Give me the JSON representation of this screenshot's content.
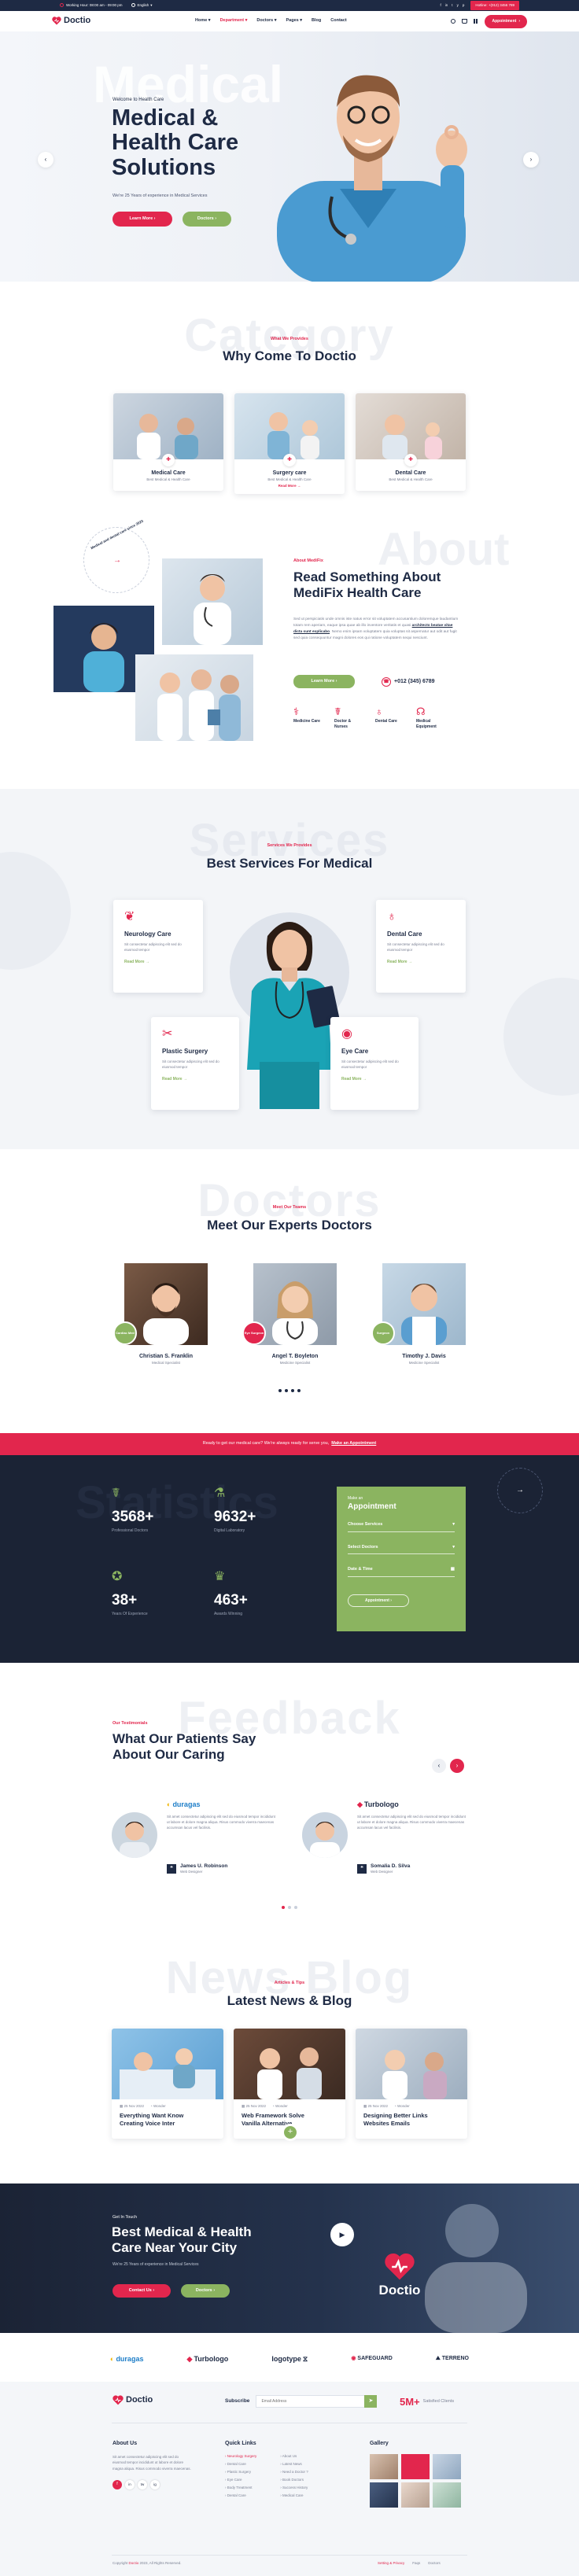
{
  "topbar": {
    "hours": "Working Hour: 08:00 am - 09:00 pm",
    "language": "English",
    "social": [
      "f",
      "in",
      "t",
      "y",
      "p"
    ],
    "hotline": "Hotline: +(012) 3456 789"
  },
  "nav": {
    "logo": "Doctio",
    "items": [
      "Home",
      "Department",
      "Doctors",
      "Pages",
      "Blog",
      "Contact"
    ],
    "active": "Department",
    "appointment": "Appointment"
  },
  "hero": {
    "ghost": "Medical",
    "kicker": "Welcome to Health Care",
    "title_lines": [
      "Medical &",
      "Health Care",
      "Solutions"
    ],
    "sub": "We're 25 Years of experience in Medical Services",
    "btn_primary": "Learn More",
    "btn_secondary": "Doctors"
  },
  "why": {
    "ghost": "Category",
    "kicker": "What We Provides",
    "title": "Why Come To Doctio",
    "cards": [
      {
        "title": "Medical Care",
        "text": "Best Medical & Health Care",
        "link": ""
      },
      {
        "title": "Surgery care",
        "text": "Best Medical & Health Care",
        "link": "Read More"
      },
      {
        "title": "Dental Care",
        "text": "Best Medical & Health Care",
        "link": ""
      }
    ]
  },
  "about": {
    "ghost": "About",
    "badge": "Medical and dental care since 2020",
    "kicker": "About MediFix",
    "title_lines": [
      "Read Something About",
      "MediFix Health Care"
    ],
    "para1": "Sed ut perspiciatis unde omnis iste natus error sit voluptatem accusantium doloremque laudantium totam rem aperiam, eaque ipsa quae ab illo inventore veritatis et quasi",
    "para1_link": "architecto beatae vitae dicta sunt explicabo",
    "para1_end": ". Nemo enim ipsam voluptatem quia voluptas sit aspernatur aut odit aut fugit sed quia consequuntur magni dolores eos qui ratione voluptatem sequi nesciunt.",
    "btn": "Learn More",
    "phone": "+012 (345) 6789",
    "features": [
      "Medicine Care",
      "Doctor & Nurses",
      "Dental Care",
      "Medical Equipment"
    ]
  },
  "services": {
    "ghost": "Services",
    "kicker": "Services We Provides",
    "title": "Best Services For Medical",
    "items": [
      {
        "title": "Neurology Care",
        "text": "Sit consectetur adipiscing elit sed do eiusmod tempor",
        "link": "Read More"
      },
      {
        "title": "Dental Care",
        "text": "Sit consectetur adipiscing elit sed do eiusmod tempor",
        "link": "Read More"
      },
      {
        "title": "Plastic Surgery",
        "text": "Sit consectetur adipiscing elit sed do eiusmod tempor",
        "link": "Read More"
      },
      {
        "title": "Eye Care",
        "text": "Sit consectetur adipiscing elit sed do eiusmod tempor",
        "link": "Read More"
      }
    ]
  },
  "team": {
    "ghost": "Doctors",
    "kicker": "Meet Our Teams",
    "title": "Meet Our Experts Doctors",
    "doctors": [
      {
        "badge": "Cardiac Med",
        "name": "Christian S. Franklin",
        "role": "Medical Specialist"
      },
      {
        "badge": "Eye Surgeon",
        "name": "Angel T. Boyleton",
        "role": "Medicine Specialist"
      },
      {
        "badge": "Surgeon",
        "name": "Timothy J. Davis",
        "role": "Medicine Specialist"
      }
    ]
  },
  "cta_bar": {
    "text": "Ready to get our medical care? We're always ready for serve you,",
    "link": "Make an Appointment"
  },
  "stats": {
    "ghost": "Statistics",
    "items": [
      {
        "value": "3568+",
        "label": "Professional Doctors"
      },
      {
        "value": "9632+",
        "label": "Digital Laboratory"
      },
      {
        "value": "38+",
        "label": "Years Of Experience"
      },
      {
        "value": "463+",
        "label": "Awards Winning"
      }
    ],
    "form": {
      "kicker": "Make an",
      "title": "Appointment",
      "fields": [
        "Choose Services",
        "Select Doctors",
        "Date & Time"
      ],
      "button": "Appointment"
    }
  },
  "testimonials": {
    "ghost": "Feedback",
    "kicker": "Our Testimonials",
    "title_lines": [
      "What Our Patients Say",
      "About Our Caring"
    ],
    "items": [
      {
        "brand": "duragas",
        "text": "Sit amet consectetur adipiscing elit sed do eiusmod tempor incididunt ut labore et dolore magna aliqua. Risus commodo viverra maecenas accumsan lacus vel facilisis.",
        "name": "James U. Robinson",
        "role": "Web Designer"
      },
      {
        "brand": "Turbologo",
        "text": "Sit amet consectetur adipiscing elit sed do eiusmod tempor incididunt ut labore et dolore magna aliqua. Risus commodo viverra maecenas accumsan lacus vel facilisis.",
        "name": "Somalia D. Silva",
        "role": "Web Designer"
      }
    ]
  },
  "news": {
    "ghost": "News Blog",
    "kicker": "Articles & Tips",
    "title": "Latest News & Blog",
    "posts": [
      {
        "date": "25 Nov 2022",
        "author": "Wonder",
        "title_lines": [
          "Everything Want Know",
          "Creating Voice Inter"
        ]
      },
      {
        "date": "25 Nov 2022",
        "author": "Wonder",
        "title_lines": [
          "Web Framework Solve",
          "Vanilla Alternative"
        ]
      },
      {
        "date": "25 Nov 2022",
        "author": "Wonder",
        "title_lines": [
          "Designing Better Links",
          "Websites Emails"
        ]
      }
    ]
  },
  "banner": {
    "kicker": "Get In Touch",
    "title_lines": [
      "Best Medical & Health",
      "Care Near Your City"
    ],
    "sub": "We're 25 Years of experience in Medical Services",
    "btn_primary": "Contact Us",
    "btn_secondary": "Doctors",
    "logo": "Doctio"
  },
  "brands": [
    "duragas",
    "Turbologo",
    "logotype",
    "SAFEGUARD",
    "TERRENO"
  ],
  "footer": {
    "logo": "Doctio",
    "subscribe_label": "Subscribe",
    "email_placeholder": "Email Address",
    "clients_value": "5M+",
    "clients_label": "Satisfied Clients",
    "about_title": "About Us",
    "about_text": "Sit amet consectetur adipiscing elit sed do eiusmod tempor incididunt ut labore et dolore magna aliqua. Risus commodo viverra maecenas.",
    "social": [
      "f",
      "in",
      "tw",
      "ig"
    ],
    "quick_title": "Quick Links",
    "quick_col1": [
      "Neurology Surgery",
      "Dental Care",
      "Plastic Surgery",
      "Eye Care",
      "Body Treatment",
      "Dental Care"
    ],
    "quick_col2": [
      "About Us",
      "Latest News",
      "Need a Doctor ?",
      "Book Doctors",
      "Success History",
      "Medical Care"
    ],
    "gallery_title": "Gallery",
    "copyright_pre": "Copyright ",
    "copyright_brand": "Doctio",
    "copyright_post": " 2023, All Rights Reserved.",
    "bottom_links": [
      "Setting & Privacy",
      "Faqs",
      "Doctors"
    ]
  },
  "colors": {
    "primary": "#e2264d",
    "secondary": "#8bb460",
    "dark": "#1e2a44",
    "dark_band": "#1b2335"
  }
}
